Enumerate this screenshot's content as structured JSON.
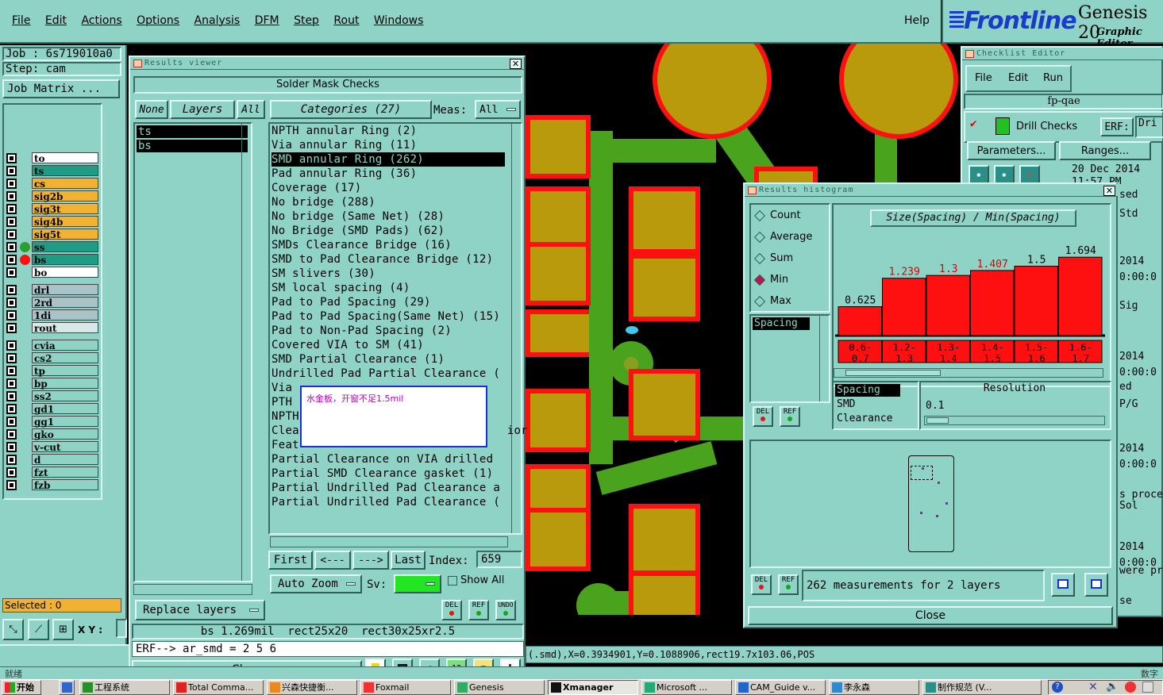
{
  "menu": {
    "items": [
      "File",
      "Edit",
      "Actions",
      "Options",
      "Analysis",
      "DFM",
      "Step",
      "Rout",
      "Windows"
    ],
    "help": "Help"
  },
  "brand": {
    "logo": "Frontline",
    "product": "Genesis 20",
    "subtitle": "Graphic Editor"
  },
  "job": {
    "job_label": "Job  : 6s719010a0",
    "step_label": "Step: cam",
    "matrix_button": "Job Matrix ..."
  },
  "layers": {
    "group1": [
      "to",
      "ts",
      "cs",
      "sig2b",
      "sig3t",
      "sig4b",
      "sig5t",
      "ss",
      "bs",
      "bo"
    ],
    "group2": [
      "drl",
      "2rd",
      "1di",
      "rout"
    ],
    "group3": [
      "cvia",
      "cs2",
      "tp",
      "bp",
      "ss2",
      "gd1",
      "gg1",
      "gko",
      "v-cut",
      "d",
      "fzt",
      "fzb"
    ],
    "selected_label": "Selected : 0",
    "xy_label": "X Y :"
  },
  "results_viewer": {
    "title": "Results viewer",
    "header": "Solder Mask Checks",
    "none_btn": "None",
    "layers_btn": "Layers",
    "all_btn": "All",
    "categories_btn": "Categories (27)",
    "meas_label": "Meas:",
    "meas_value": "All",
    "layer_list": [
      "ts",
      "bs"
    ],
    "categories": [
      "NPTH annular Ring (2)",
      "Via annular Ring (11)",
      "SMD annular Ring (262)",
      "Pad annular Ring (36)",
      "Coverage (17)",
      "No bridge (288)",
      "No bridge (Same Net) (28)",
      "No Bridge (SMD Pads) (62)",
      "SMDs Clearance Bridge (16)",
      "SMD to Pad Clearance Bridge (12)",
      "SM slivers (30)",
      "SM local spacing (4)",
      "Pad to Pad Spacing (29)",
      "Pad to Pad Spacing(Same Net) (15)",
      "Pad to Non-Pad Spacing (2)",
      "Covered VIA to SM (41)",
      "SMD Partial Clearance (1)",
      "Undrilled Pad Partial Clearance (",
      "Via",
      "PTH",
      "NPTH",
      "Clea                              ior",
      "Feat",
      "Partial Clearance on VIA drilled",
      "Partial SMD Clearance gasket (1)",
      "Partial Undrilled Pad Clearance a",
      "Partial Undrilled Pad Clearance ("
    ],
    "first_btn": "First",
    "prev_btn": "<---",
    "next_btn": "--->",
    "last_btn": "Last",
    "index_label": "Index:",
    "index_value": "659",
    "auto_zoom_btn": "Auto Zoom",
    "sv_label": "Sv:",
    "show_all_label": "Show All",
    "replace_layers_btn": "Replace layers",
    "del_icon": "DEL",
    "ref_icon": "REF",
    "undo_icon": "UNDO",
    "info_line": "bs 1.269mil  rect25x20  rect30x25xr2.5",
    "erf_line": "ERF--> ar_smd = 2 5 6",
    "close_btn": "Close"
  },
  "tooltip": {
    "text": "水金板，开窗不足1.5mil"
  },
  "checklist": {
    "title": "Checklist Editor",
    "menu": [
      "File",
      "Edit",
      "Run"
    ],
    "name": "fp-qae",
    "drill_checks": "Drill Checks",
    "erf_label": "ERF:",
    "erf_value": "Dri",
    "parameters_btn": "Parameters...",
    "ranges_btn": "Ranges...",
    "date": "20 Dec 2014",
    "time": "11:57 PM",
    "right_frag": [
      "sed",
      "Std",
      "2014",
      "0:00:0",
      "Sig",
      "2014",
      "0:00:0",
      "ed",
      "P/G",
      "2014",
      "0:00:0",
      "s proce",
      "Sol",
      "2014",
      "0:00:0",
      "were pr",
      "se"
    ]
  },
  "histogram": {
    "title": "Results histogram",
    "modes": [
      "Count",
      "Average",
      "Sum",
      "Min",
      "Max"
    ],
    "selected_mode": "Min",
    "header": "Size(Spacing) / Min(Spacing)",
    "left_list": [
      "Spacing"
    ],
    "right_list": [
      "Spacing",
      "SMD",
      "Clearance"
    ],
    "resolution_label": "Resolution",
    "resolution_value": "0.1",
    "summary": "262 measurements for 2 layers",
    "close_btn": "Close"
  },
  "chart_data": {
    "type": "bar",
    "title": "Size(Spacing) / Min(Spacing)",
    "categories": [
      "0.6-0.7",
      "1.2-1.3",
      "1.3-1.4",
      "1.4-1.5",
      "1.5-1.6",
      "1.6-1.7"
    ],
    "values": [
      0.625,
      1.239,
      1.3,
      1.407,
      1.5,
      1.694
    ],
    "value_labels": [
      "0.625",
      "1.239",
      "1.3",
      "1.407",
      "1.5",
      "1.694"
    ],
    "xlabel": "",
    "ylabel": "",
    "ylim": [
      0,
      1.8
    ],
    "bar_color": "#ff1010"
  },
  "status_bar": {
    "coords": "(.smd),X=0.3934901,Y=0.1088906,rect19.7x103.06,POS",
    "left": "就绪",
    "right": "数字"
  },
  "taskbar": {
    "start": "开始",
    "items": [
      "工程系统",
      "Total Comma...",
      "兴森快捷衡...",
      "Foxmail",
      "Genesis",
      "Xmanager",
      "Microsoft ...",
      "CAM_Guide v...",
      "李永森",
      "制作规范 (V..."
    ]
  }
}
